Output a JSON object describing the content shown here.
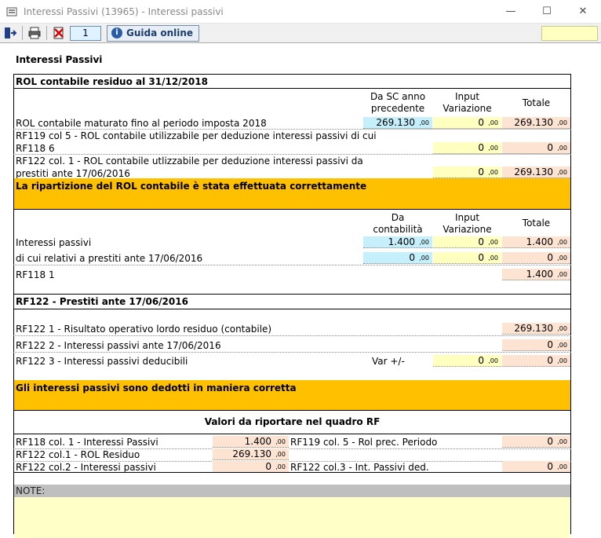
{
  "window": {
    "title": "Interessi Passivi (13965) - Interessi passivi",
    "minimize_glyph": "—",
    "maximize_glyph": "☐",
    "close_glyph": "✕"
  },
  "toolbar": {
    "exit_icon": "exit-icon",
    "print_icon": "printer-icon",
    "delete_icon": "delete-icon",
    "page_number": "1",
    "help_label": "Guida online",
    "help_glyph": "i"
  },
  "page_title": "Interessi Passivi",
  "rol_section": {
    "title": "ROL contabile residuo al 31/12/2018",
    "col1_header_l1": "Da SC anno",
    "col1_header_l2": "precedente",
    "col2_header_l1": "Input",
    "col2_header_l2": "Variazione",
    "col3_header": "Totale",
    "rows": [
      {
        "label_l1": "ROL contabile maturato fino al periodo imposta 2018",
        "label_l2": "",
        "v1": "269.130",
        "v2": "0",
        "v3": "269.130"
      },
      {
        "label_l1": "RF119 col 5  - ROL contabile utilizzabile per deduzione interessi passivi di cui",
        "label_l2": "RF118  6",
        "v1": "",
        "v2": "0",
        "v3": "0"
      },
      {
        "label_l1": "RF122 col. 1 - ROL contabile utlizzabile per deduzione interessi passivi da",
        "label_l2": "prestiti ante 17/06/2016",
        "v1": "",
        "v2": "0",
        "v3": "269.130"
      }
    ],
    "decimals": ",00"
  },
  "banner1": "La ripartizione del ROL contabile è stata effettuata correttamente",
  "ip_section": {
    "col1_header_l1": "Da",
    "col1_header_l2": "contabilità",
    "col2_header_l1": "Input",
    "col2_header_l2": "Variazione",
    "col3_header": "Totale",
    "rows": [
      {
        "label": "Interessi passivi",
        "v1": "1.400",
        "v2": "0",
        "v3": "1.400"
      },
      {
        "label": "di cui relativi a prestiti ante 17/06/2016",
        "v1": "0",
        "v2": "0",
        "v3": "0"
      },
      {
        "label": "RF118  1",
        "v3": "1.400"
      }
    ]
  },
  "rf122_section": {
    "title": "RF122 - Prestiti ante 17/06/2016",
    "rows": [
      {
        "label": "RF122  1 - Risultato operativo lordo residuo  (contabile)",
        "v3": "269.130"
      },
      {
        "label": "RF122  2 - Interessi passivi ante 17/06/2016",
        "v3": "0"
      },
      {
        "label": "RF122  3 -  Interessi passivi deducibili",
        "var_label": "Var +/-",
        "v2": "0",
        "v3": "0"
      }
    ]
  },
  "banner2": "Gli interessi passivi sono dedotti in maniera corretta",
  "quadro": {
    "title": "Valori da riportare nel quadro RF",
    "left": [
      {
        "label": "RF118 col. 1 - Interessi Passivi",
        "value": "1.400"
      },
      {
        "label": "RF122 col.1 - ROL Residuo",
        "value": "269.130"
      },
      {
        "label": "RF122 col.2 - Interessi passivi",
        "value": "0"
      }
    ],
    "right": [
      {
        "label": "RF119 col. 5 - Rol prec. Periodo",
        "value": "0"
      },
      {
        "label": "RF122 col.3 - Int. Passivi ded.",
        "value": "0"
      }
    ]
  },
  "notes_label": "NOTE:",
  "colors": {
    "blue_cell": "#c5f0fb",
    "yellow_cell": "#ffffc0",
    "orange_cell": "#fce3d2",
    "banner": "#ffc000"
  }
}
